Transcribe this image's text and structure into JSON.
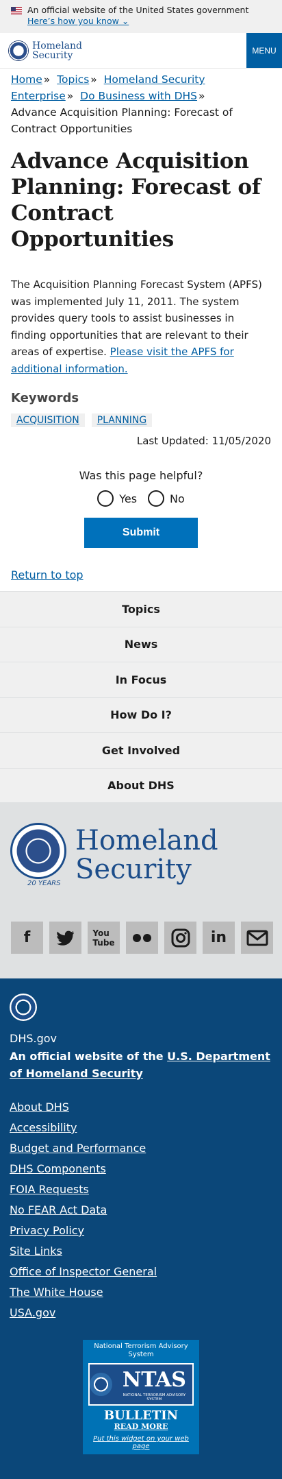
{
  "banner": {
    "official_text": "An official website of the United States government",
    "how_link": "Here’s how you know ⌄"
  },
  "header": {
    "logo_line1": "Homeland",
    "logo_line2": "Security",
    "menu_label": "MENU"
  },
  "breadcrumb": {
    "items": [
      "Home",
      "Topics",
      "Homeland Security Enterprise",
      "Do Business with DHS"
    ],
    "separator": "»",
    "current": "Advance Acquisition Planning: Forecast of Contract Opportunities"
  },
  "page": {
    "title": "Advance Acquisition Planning: Forecast of Contract Opportunities",
    "body": "The Acquisition Planning Forecast System (APFS) was implemented July 11, 2011. The system provides query tools to assist businesses in finding opportunities that are relevant to their areas of expertise.",
    "body_link": "Please visit the APFS for additional information.",
    "keywords_heading": "Keywords",
    "keywords": [
      "ACQUISITION",
      "PLANNING"
    ],
    "last_updated": "Last Updated: 11/05/2020"
  },
  "feedback": {
    "question": "Was this page helpful?",
    "yes": "Yes",
    "no": "No",
    "submit": "Submit"
  },
  "return_top": "Return to top",
  "footer_nav": [
    "Topics",
    "News",
    "In Focus",
    "How Do I?",
    "Get Involved",
    "About DHS"
  ],
  "brand": {
    "line1": "Homeland",
    "line2": "Security",
    "seal_text": "20 YEARS"
  },
  "social_icons": [
    "facebook-icon",
    "twitter-icon",
    "youtube-icon",
    "flickr-icon",
    "instagram-icon",
    "linkedin-icon",
    "email-icon"
  ],
  "footer": {
    "site": "DHS.gov",
    "official_prefix": "An official website of the ",
    "official_link": "U.S. Department of Homeland Security",
    "links": [
      "About DHS",
      "Accessibility",
      "Budget and Performance",
      "DHS Components",
      "FOIA Requests",
      "No FEAR Act Data",
      "Privacy Policy",
      "Site Links",
      "Office of Inspector General",
      "The White House",
      "USA.gov"
    ]
  },
  "ntas": {
    "heading": "National Terrorism Advisory System",
    "brand": "NTAS",
    "subtitle": "NATIONAL TERRORISM ADVISORY SYSTEM",
    "bulletin": "BULLETIN",
    "read_more": "READ MORE",
    "widget_link": "Put this widget on your web page"
  },
  "colors": {
    "primary": "#005ea2",
    "button": "#0071bb",
    "footer_blue": "#0b4779",
    "brand_navy": "#1c4d8a"
  }
}
